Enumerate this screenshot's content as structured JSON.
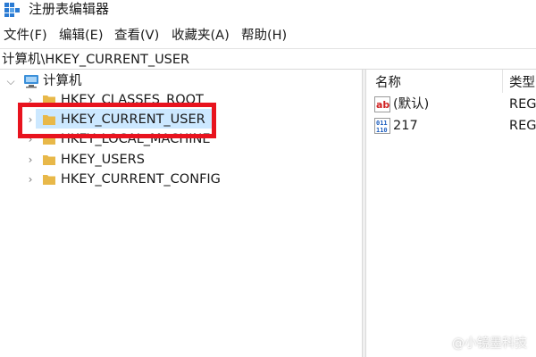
{
  "window": {
    "title": "注册表编辑器",
    "icon": "regedit-icon"
  },
  "menu": {
    "items": [
      "文件(F)",
      "编辑(E)",
      "查看(V)",
      "收藏夹(A)",
      "帮助(H)"
    ]
  },
  "address_bar": {
    "path": "计算机\\HKEY_CURRENT_USER"
  },
  "tree": {
    "root_label": "计算机",
    "items": [
      {
        "label": "HKEY_CLASSES_ROOT"
      },
      {
        "label": "HKEY_CURRENT_USER",
        "selected": true
      },
      {
        "label": "HKEY_LOCAL_MACHINE"
      },
      {
        "label": "HKEY_USERS"
      },
      {
        "label": "HKEY_CURRENT_CONFIG"
      }
    ]
  },
  "values_list": {
    "columns": [
      "名称",
      "类型"
    ],
    "rows": [
      {
        "name": "(默认)",
        "type": "REG_",
        "icon": "string-value-icon"
      },
      {
        "name": "217",
        "type": "REG_",
        "icon": "binary-value-icon"
      }
    ]
  },
  "watermark": "@小镜墨科技",
  "colors": {
    "highlight_border": "#e8131e",
    "selection": "#cce8ff",
    "folder": "#e8b849"
  }
}
